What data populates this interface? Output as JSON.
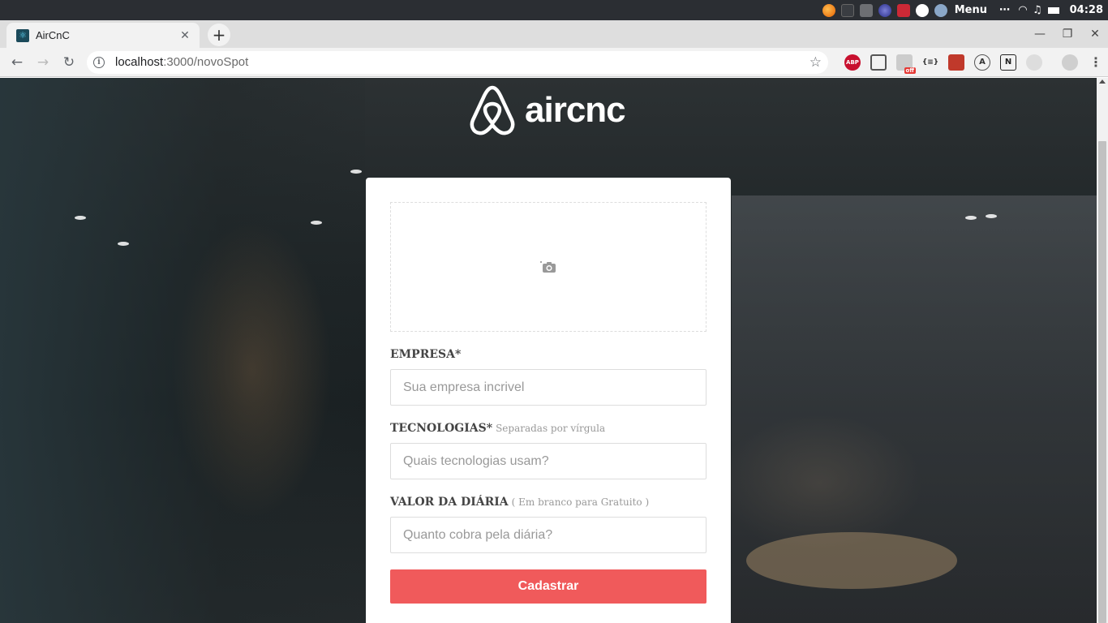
{
  "os_bar": {
    "menu_label": "Menu",
    "clock": "04:28"
  },
  "browser": {
    "tab_title": "AirCnC",
    "tab_close": "✕",
    "new_tab": "+",
    "url_host": "localhost",
    "url_path": ":3000/novoSpot",
    "ext_abp": "ABP",
    "ext_off": "off",
    "ext_json": "{≡}",
    "ext_a": "A",
    "ext_n": "N"
  },
  "page": {
    "logo_text": "aircnc",
    "company_label": "EMPRESA*",
    "company_placeholder": "Sua empresa incrivel",
    "techs_label": "TECNOLOGIAS*",
    "techs_hint": "Separadas por vírgula",
    "techs_placeholder": "Quais tecnologias usam?",
    "price_label": "VALOR DA DIÁRIA",
    "price_hint": "( Em branco para Gratuito )",
    "price_placeholder": "Quanto cobra pela diária?",
    "submit_label": "Cadastrar"
  },
  "colors": {
    "accent": "#f05a5b",
    "os_bar": "#2b2e33"
  }
}
